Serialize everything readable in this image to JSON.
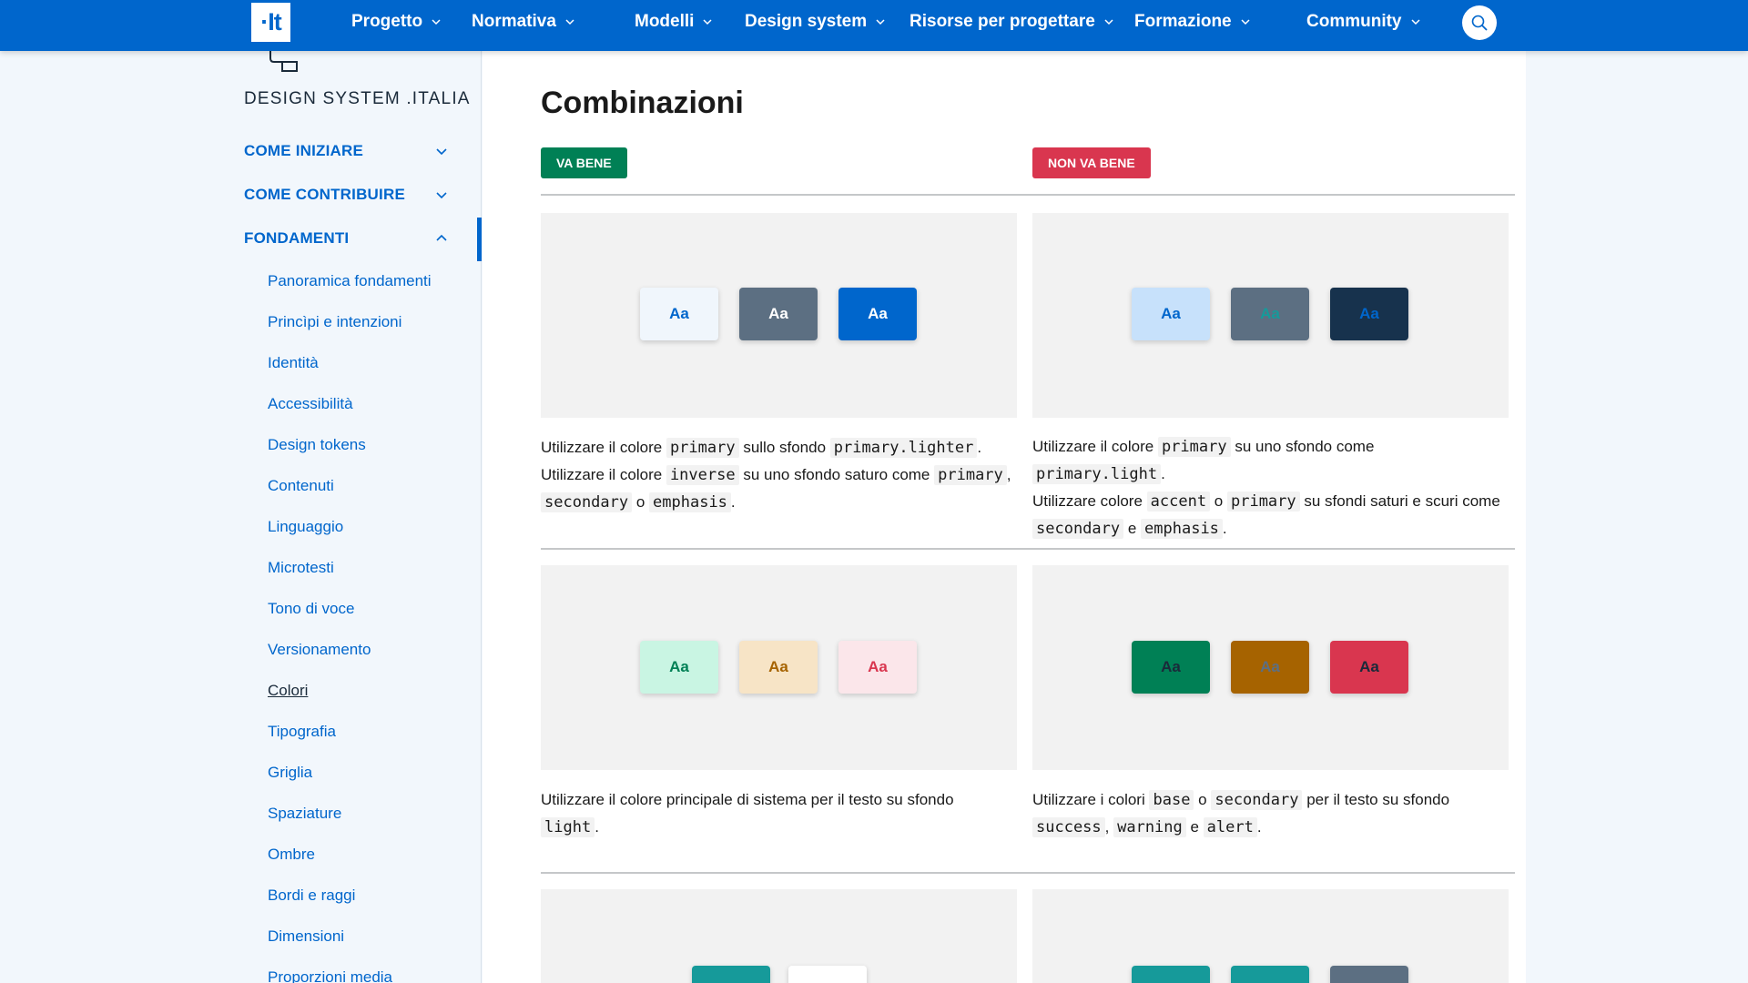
{
  "nav": {
    "logo": "·It",
    "items": [
      "Progetto",
      "Normativa",
      "Modelli",
      "Design system",
      "Risorse per progettare",
      "Formazione",
      "Community"
    ]
  },
  "sidebar": {
    "brand": "DESIGN SYSTEM .ITALIA",
    "sections": [
      "COME INIZIARE",
      "COME CONTRIBUIRE",
      "FONDAMENTI"
    ],
    "items": [
      "Panoramica fondamenti",
      "Princìpi e intenzioni",
      "Identità",
      "Accessibilità",
      "Design tokens",
      "Contenuti",
      "Linguaggio",
      "Microtesti",
      "Tono di voce",
      "Versionamento",
      "Colori",
      "Tipografia",
      "Griglia",
      "Spaziature",
      "Ombre",
      "Bordi e raggi",
      "Dimensioni",
      "Proporzioni media"
    ],
    "current": "Colori"
  },
  "main": {
    "title": "Combinazioni",
    "ok_label": "VA BENE",
    "ko_label": "NON VA BENE",
    "swatch_text": "Aa",
    "row1": {
      "ok": {
        "l1a": "Utilizzare il colore ",
        "l1c1": "primary",
        "l1b": " sullo sfondo ",
        "l1c2": "primary.lighter",
        "l1d": ".",
        "l2a": "Utilizzare il colore ",
        "l2c1": "inverse",
        "l2b": " su uno sfondo saturo come ",
        "l2c2": "primary",
        "l2d": ",",
        "l3c1": "secondary",
        "l3a": " o ",
        "l3c2": "emphasis",
        "l3b": "."
      },
      "ko": {
        "l1a": "Utilizzare il colore ",
        "l1c1": "primary",
        "l1b": " su uno sfondo come ",
        "l1c2": "primary.light",
        "l1d": ".",
        "l2a": "Utilizzare colore ",
        "l2c1": "accent",
        "l2b": " o ",
        "l2c2": "primary",
        "l2d": " su sfondi saturi e scuri come",
        "l3c1": "secondary",
        "l3a": " e ",
        "l3c2": "emphasis",
        "l3b": "."
      }
    },
    "row2": {
      "ok": {
        "a": "Utilizzare il colore principale di sistema per il testo su sfondo ",
        "c1": "light",
        "b": "."
      },
      "ko": {
        "l1a": "Utilizzare i colori ",
        "l1c1": "base",
        "l1b": " o ",
        "l1c2": "secondary",
        "l1d": " per il testo su sfondo",
        "l2c1": "success",
        "l2a": ", ",
        "l2c2": "warning",
        "l2b": " e ",
        "l2c3": "alert",
        "l2d": "."
      }
    }
  },
  "colors": {
    "primary": "#0066cc",
    "ok": "#008055",
    "ko": "#d9364f"
  }
}
